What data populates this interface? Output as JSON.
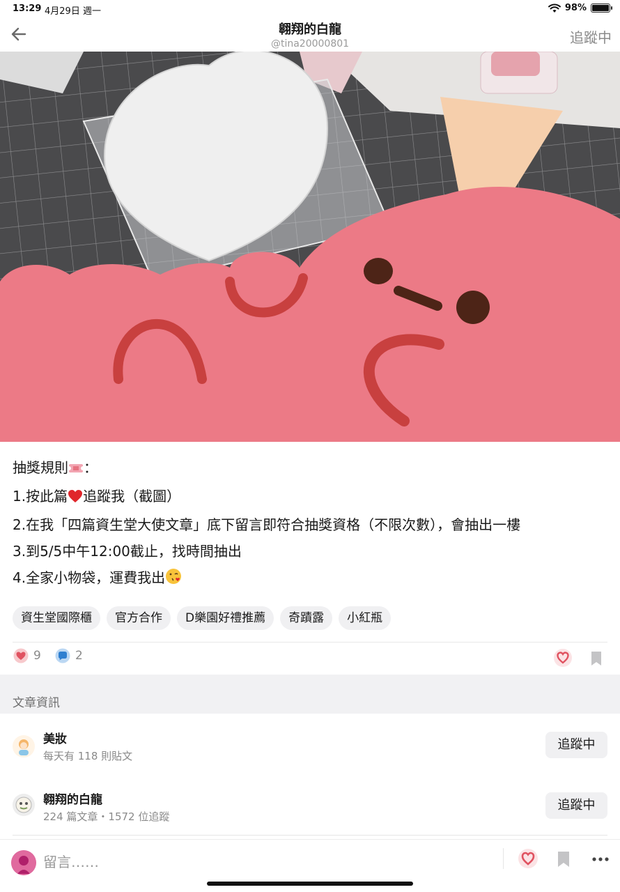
{
  "status_bar": {
    "time": "13:29",
    "date": "4月29日 週一",
    "battery": "98%",
    "battery_level": 0.98
  },
  "header": {
    "title": "翱翔的白龍",
    "handle": "@tina20000801",
    "follow_label": "追蹤中"
  },
  "post": {
    "line1": "抽獎規則",
    "line1_suffix": "：",
    "line2a": "1.按此篇",
    "line2b": "追蹤我（截圖）",
    "line3": "2.在我「四篇資生堂大使文章」底下留言即符合抽獎資格（不限次數），會抽出一樓",
    "line4": "3.到5/5中午12:00截止，找時間抽出",
    "line5": "4.全家小物袋，運費我出"
  },
  "tags": [
    "資生堂國際櫃",
    "官方合作",
    "D樂園好禮推薦",
    "奇蹟露",
    "小紅瓶"
  ],
  "stats": {
    "likes": "9",
    "comments": "2"
  },
  "section": {
    "label": "文章資訊"
  },
  "boards": [
    {
      "name": "美妝",
      "meta": "每天有 118 則貼文",
      "button": "追蹤中"
    },
    {
      "name": "翱翔的白龍",
      "meta": "224 篇文章・1572 位追蹤",
      "button": "追蹤中"
    }
  ],
  "bottom": {
    "comment_placeholder": "留言……"
  },
  "colors": {
    "accent": "#e05260",
    "blob": "#ec7a86",
    "blob_stroke": "#c8403f"
  }
}
